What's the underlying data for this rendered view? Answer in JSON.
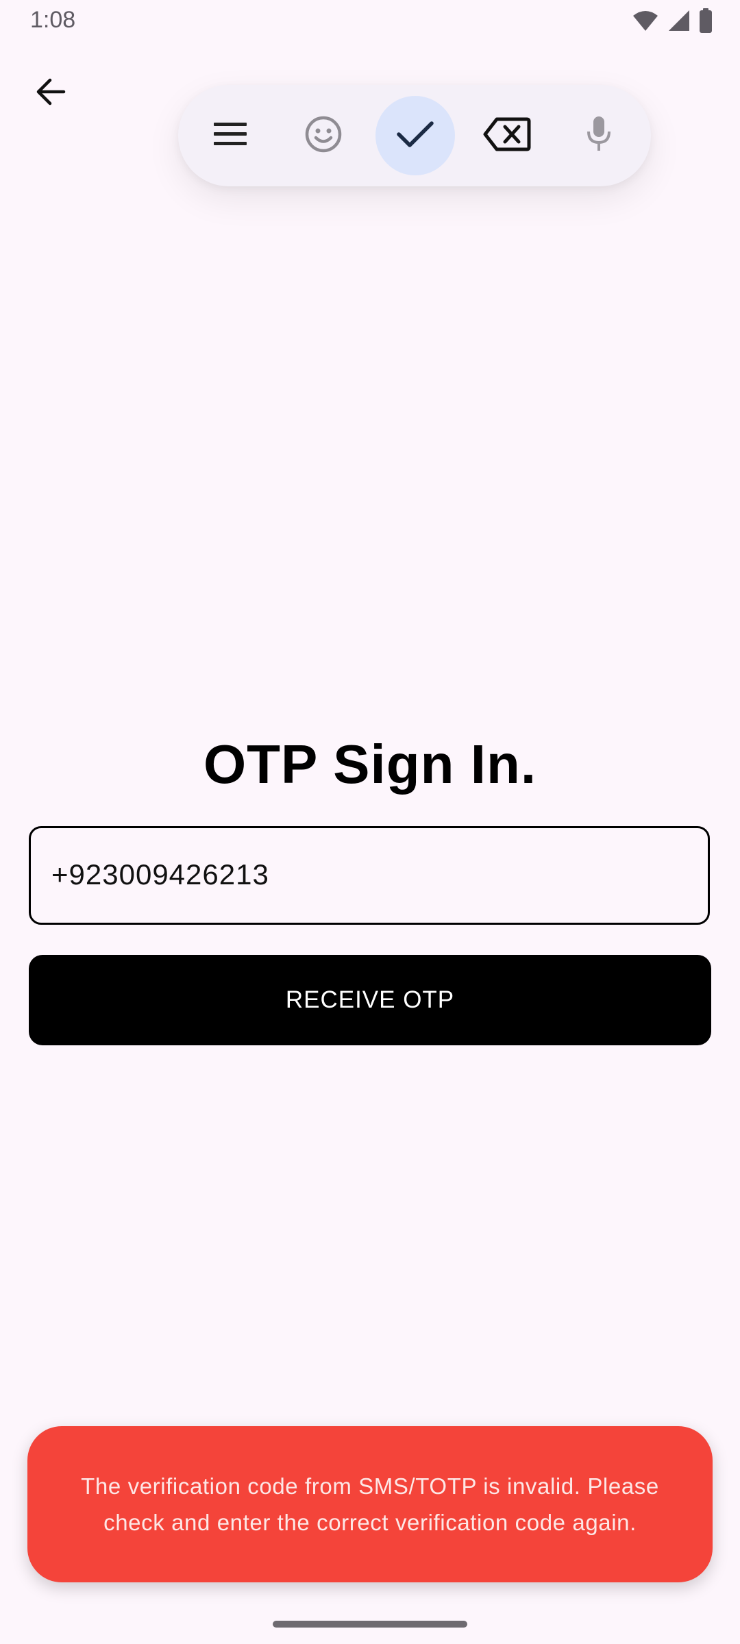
{
  "status_bar": {
    "time": "1:08",
    "icons": [
      "wifi-icon",
      "signal-icon",
      "battery-icon"
    ]
  },
  "navigation": {
    "back_icon": "arrow-back-icon"
  },
  "keyboard_toolbar": {
    "buttons": [
      {
        "icon": "menu-icon",
        "active": false
      },
      {
        "icon": "emoji-icon",
        "active": false
      },
      {
        "icon": "check-icon",
        "active": true
      },
      {
        "icon": "backspace-icon",
        "active": false
      },
      {
        "icon": "microphone-icon",
        "active": false
      }
    ]
  },
  "main": {
    "title": "OTP Sign In.",
    "phone_input": {
      "value": "+923009426213"
    },
    "receive_button_label": "RECEIVE OTP"
  },
  "error_toast": {
    "message": "The verification code from SMS/TOTP is invalid. Please check and enter the correct verification code again.",
    "background_color": "#f4443a"
  },
  "colors": {
    "background": "#fdf6fc",
    "primary_button": "#000000",
    "toolbar_active": "#dbe4fb"
  }
}
